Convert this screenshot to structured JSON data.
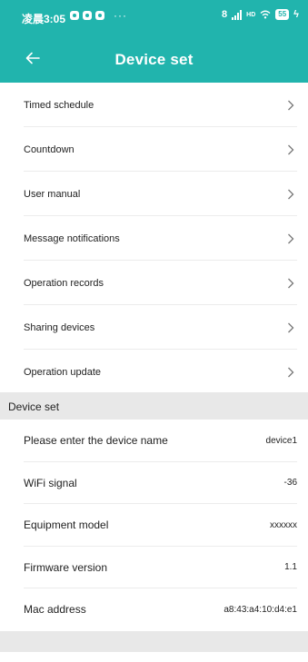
{
  "status_bar": {
    "time": "凌晨3:05",
    "more": "···",
    "bluetooth": "8",
    "network": "HD",
    "battery": "55",
    "charging": "ϟ"
  },
  "header": {
    "title": "Device set",
    "back_icon": "arrow-left-icon",
    "background_color": "#21b4ad"
  },
  "menu": {
    "items": [
      {
        "label": "Timed schedule"
      },
      {
        "label": "Countdown"
      },
      {
        "label": "User manual"
      },
      {
        "label": "Message notifications"
      },
      {
        "label": "Operation records"
      },
      {
        "label": "Sharing devices"
      },
      {
        "label": "Operation update"
      }
    ]
  },
  "section": {
    "title": "Device set"
  },
  "info": {
    "rows": [
      {
        "label": "Please enter the device name",
        "value": "device1"
      },
      {
        "label": "WiFi signal",
        "value": "-36"
      },
      {
        "label": "Equipment model",
        "value": "xxxxxx"
      },
      {
        "label": "Firmware version",
        "value": "1.1"
      },
      {
        "label": "Mac address",
        "value": "a8:43:a4:10:d4:e1"
      }
    ]
  }
}
